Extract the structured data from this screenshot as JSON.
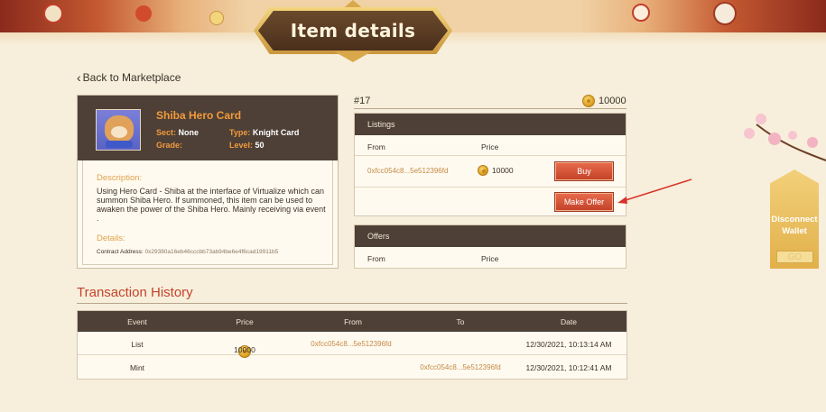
{
  "header": {
    "title": "Item details"
  },
  "nav": {
    "back_label": "Back to Marketplace"
  },
  "hero": {
    "name": "Shiba Hero Card",
    "sect_label": "Sect:",
    "sect_value": "None",
    "type_label": "Type:",
    "type_value": "Knight Card",
    "grade_label": "Grade:",
    "grade_value": "",
    "level_label": "Level:",
    "level_value": "50",
    "description_title": "Description:",
    "description": "Using Hero Card - Shiba at the interface of Virtualize which can summon Shiba Hero. If summoned, this item can be used to awaken the power of the Shiba Hero. Mainly receiving via event .",
    "details_title": "Details:",
    "contract_label": "Contract Address:",
    "contract_address": "0x29380a16eb46cccbb73ab94be6e4f6cad19911b5"
  },
  "item": {
    "id": "#17",
    "price": "10000"
  },
  "listings": {
    "title": "Listings",
    "columns": [
      "From",
      "Price"
    ],
    "rows": [
      {
        "from": "0xfcc054c8...5e512396fd",
        "price": "10000",
        "buy_label": "Buy"
      }
    ],
    "make_offer_label": "Make Offer"
  },
  "offers": {
    "title": "Offers",
    "columns": [
      "From",
      "Price"
    ]
  },
  "transactions": {
    "title": "Transaction History",
    "columns": [
      "Event",
      "Price",
      "From",
      "To",
      "Date"
    ],
    "rows": [
      {
        "event": "List",
        "price": "10000",
        "from": "0xfcc054c8...5e512396fd",
        "to": "",
        "date": "12/30/2021, 10:13:14 AM"
      },
      {
        "event": "Mint",
        "price": "",
        "from": "",
        "to": "0xfcc054c8...5e512396fd",
        "date": "12/30/2021, 10:12:41 AM"
      }
    ]
  },
  "wallet": {
    "line1": "Disconnect",
    "line2": "Wallet",
    "go_label": "GO"
  },
  "icons": {
    "back": "chevron-left-icon",
    "coin": "coin-icon",
    "annotation": "red-arrow-annotation"
  },
  "colors": {
    "accent": "#c4432a",
    "gold": "#f29a3a",
    "panel_dark": "#4e4037",
    "background": "#f7efdc"
  }
}
